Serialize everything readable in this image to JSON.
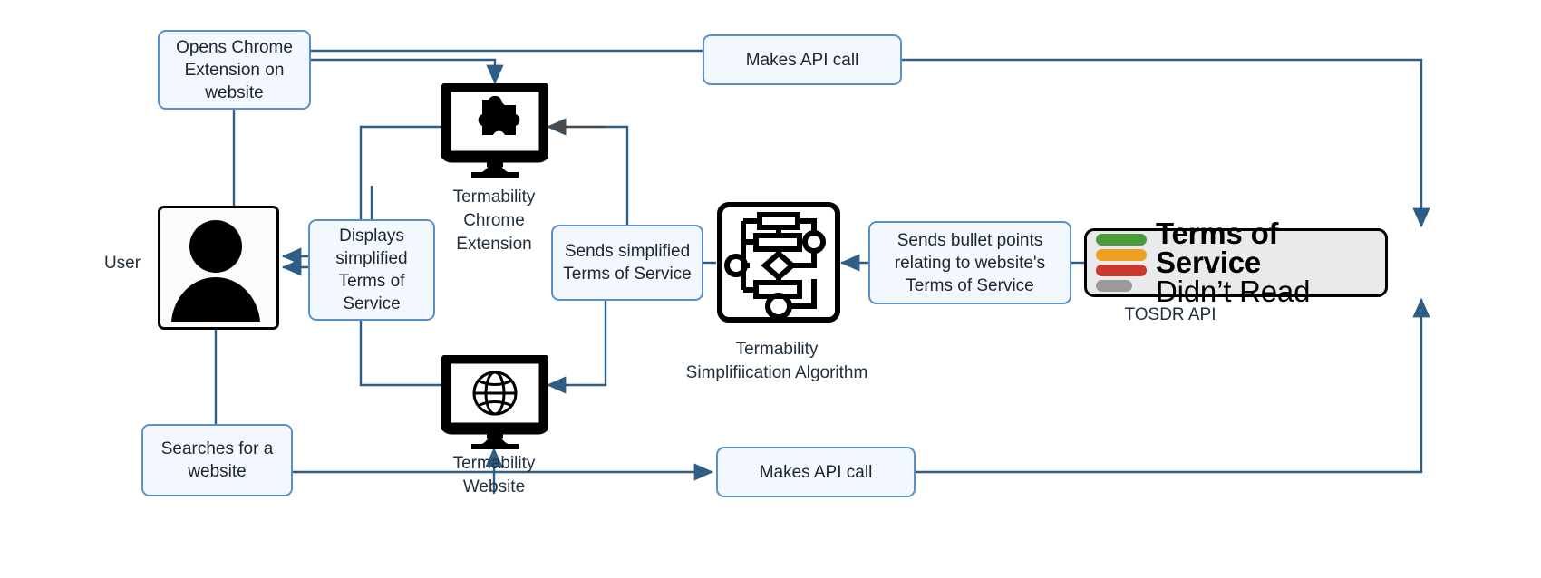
{
  "diagram": {
    "title": "Termability system flow",
    "colors": {
      "edge": "#2e5e86",
      "box_border": "#5b8fc9",
      "box_fill": "#f2f8fd",
      "icon_black": "#000000",
      "tosdr_fill": "#e8eaec",
      "tosdr_green": "#4a9b3c",
      "tosdr_orange": "#f0a020",
      "tosdr_red": "#c8392f",
      "tosdr_gray": "#9a9a9a",
      "text": "#1d2530"
    }
  },
  "nodes": {
    "opens_extension": {
      "text": "Opens Chrome Extension on website"
    },
    "makes_api_call_top": {
      "text": "Makes API call"
    },
    "makes_api_call_bottom": {
      "text": "Makes API call"
    },
    "displays_simplified": {
      "text": "Displays simplified Terms of Service"
    },
    "sends_simplified": {
      "text": "Sends simplified Terms of Service"
    },
    "sends_bullets": {
      "text": "Sends bullet points relating to website's Terms of Service"
    },
    "searches_website": {
      "text": "Searches for a website"
    }
  },
  "captions": {
    "user": "User",
    "chrome_extension": "Termability\nChrome\nExtension",
    "algorithm": "Termability\nSimplifiication Algorithm",
    "website": "Termability\nWebsite",
    "tosdr_api": "TOSDR API"
  },
  "tosdr_logo": {
    "line1": "Terms of Service",
    "line2": "Didn’t Read",
    "bars": [
      "green",
      "orange",
      "red",
      "gray"
    ]
  },
  "icons": {
    "user": "user-silhouette-icon",
    "chrome_extension": "monitor-puzzle-piece-icon",
    "algorithm": "flowchart-algorithm-icon",
    "website": "monitor-globe-icon"
  }
}
